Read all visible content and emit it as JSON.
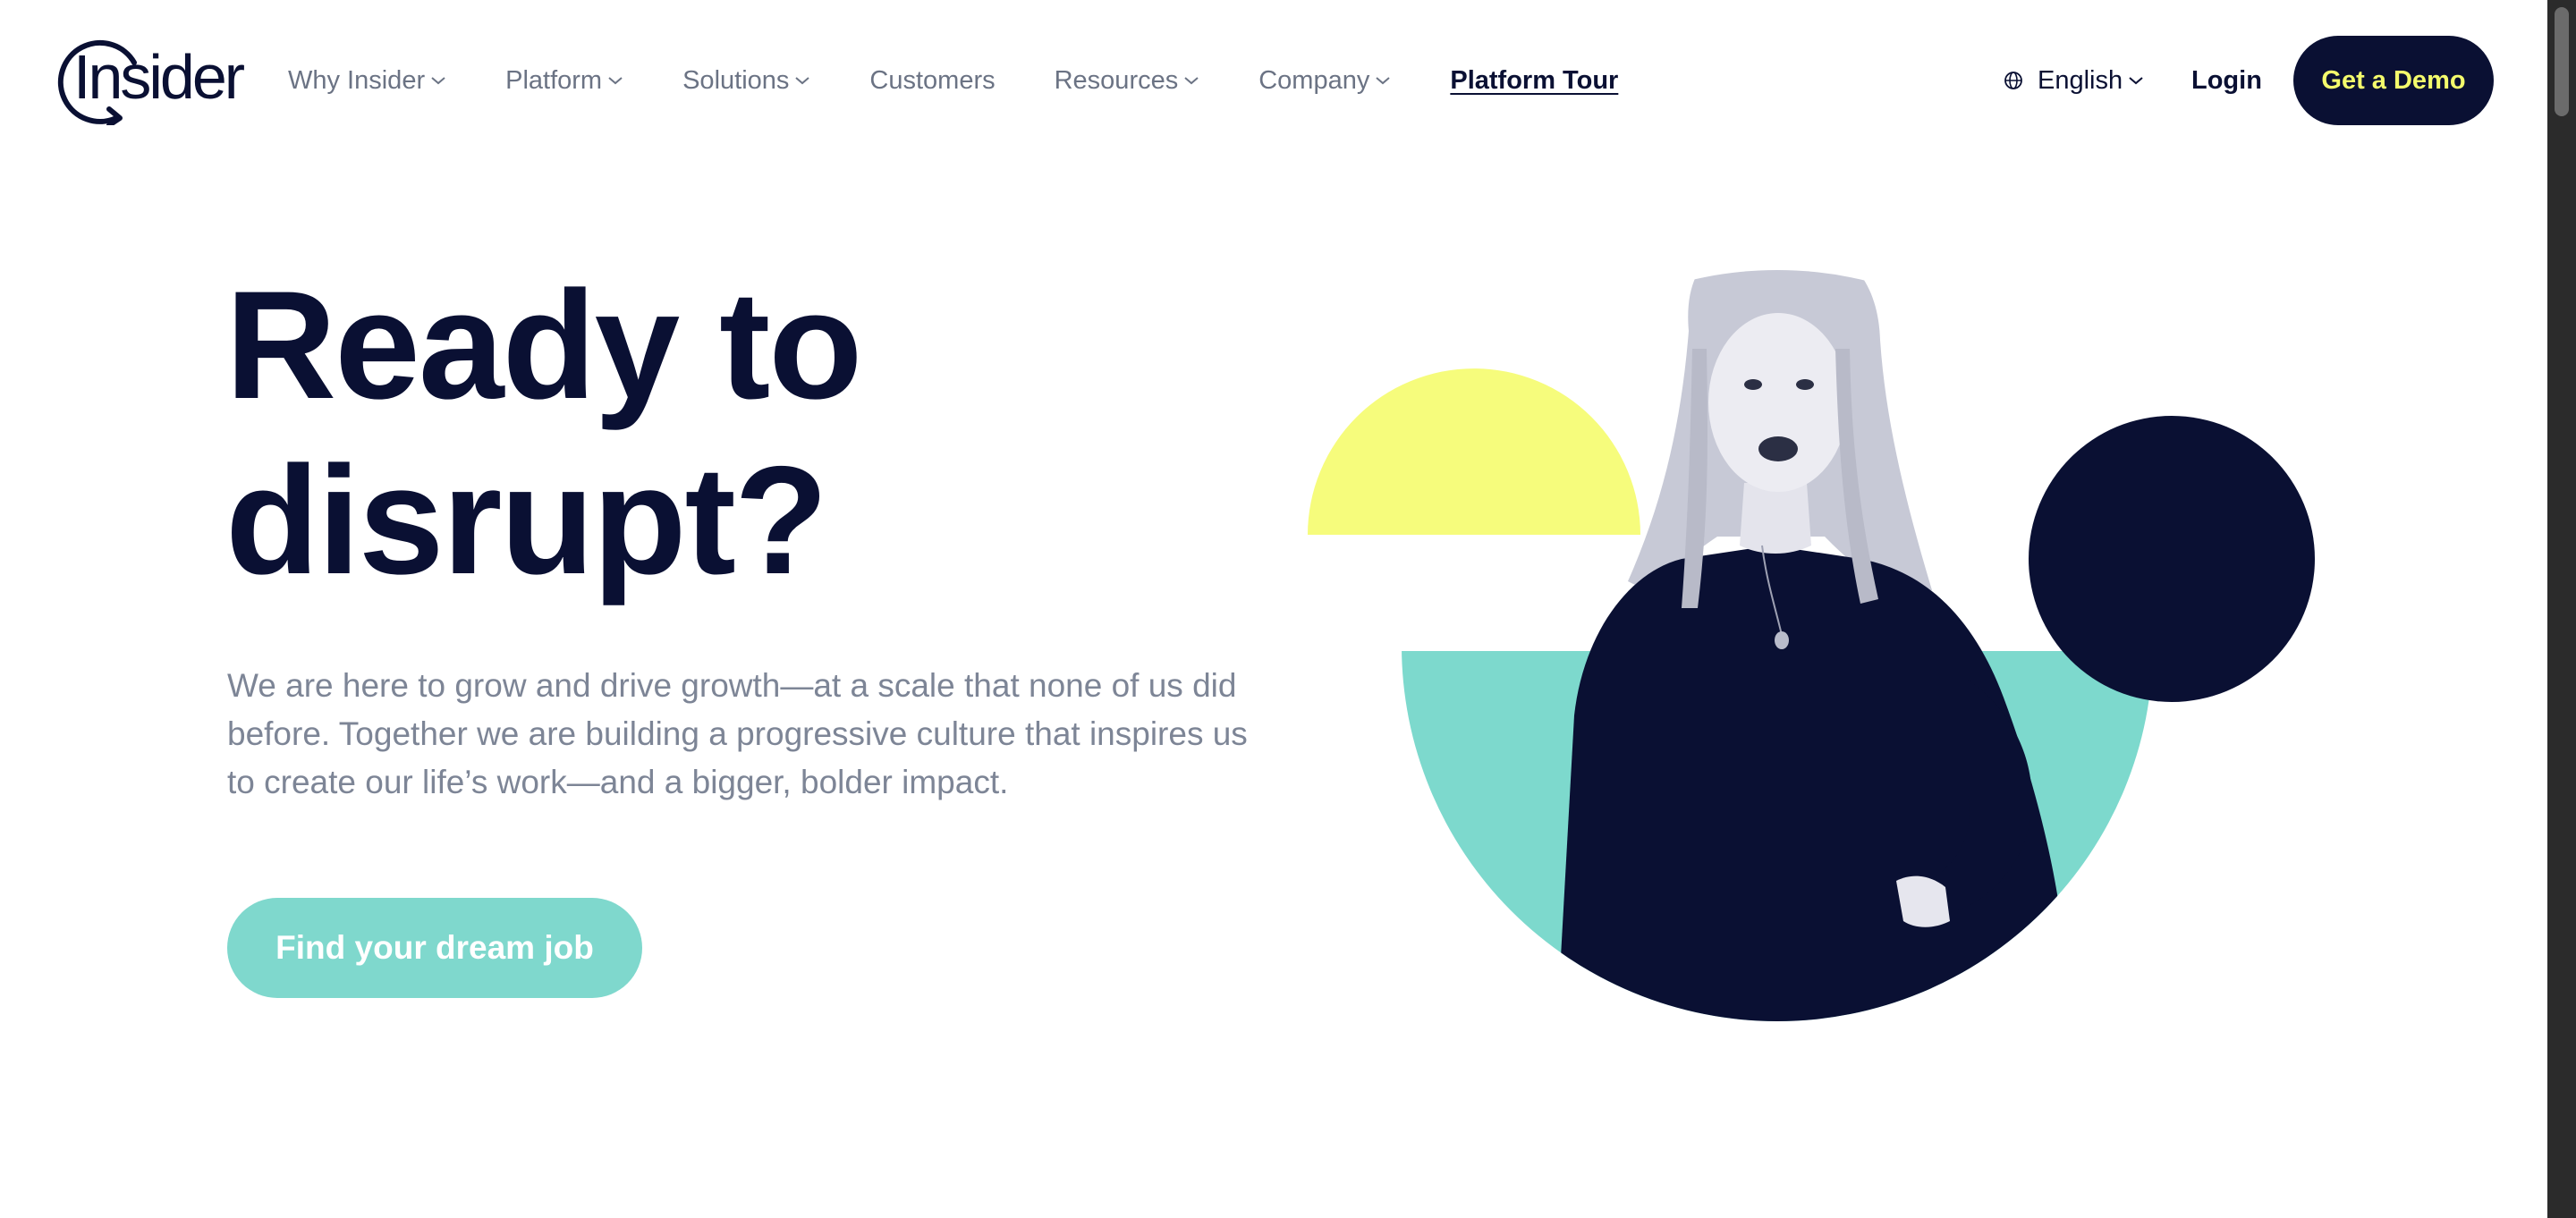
{
  "brand": {
    "logo_text": "Insider",
    "colors": {
      "navy": "#0a1033",
      "teal": "#7fd8cd",
      "yellow": "#f4fb6c",
      "gray_text": "#7d8596"
    }
  },
  "nav": {
    "items": [
      {
        "label": "Why Insider",
        "has_dropdown": true
      },
      {
        "label": "Platform",
        "has_dropdown": true
      },
      {
        "label": "Solutions",
        "has_dropdown": true
      },
      {
        "label": "Customers",
        "has_dropdown": false
      },
      {
        "label": "Resources",
        "has_dropdown": true
      },
      {
        "label": "Company",
        "has_dropdown": true
      }
    ],
    "tour_label": "Platform Tour",
    "language": "English",
    "login": "Login",
    "demo_button": "Get a Demo"
  },
  "hero": {
    "title_line1": "Ready to",
    "title_line2": "disrupt?",
    "description": "We are here to grow and drive growth—at a scale that none of us did before. Together we are building a progressive culture that inspires us to create our life’s work—and a bigger, bolder impact.",
    "cta": "Find your dream job"
  },
  "icons": {
    "nav_dropdown": "chevron-down-icon",
    "language": "globe-icon"
  }
}
